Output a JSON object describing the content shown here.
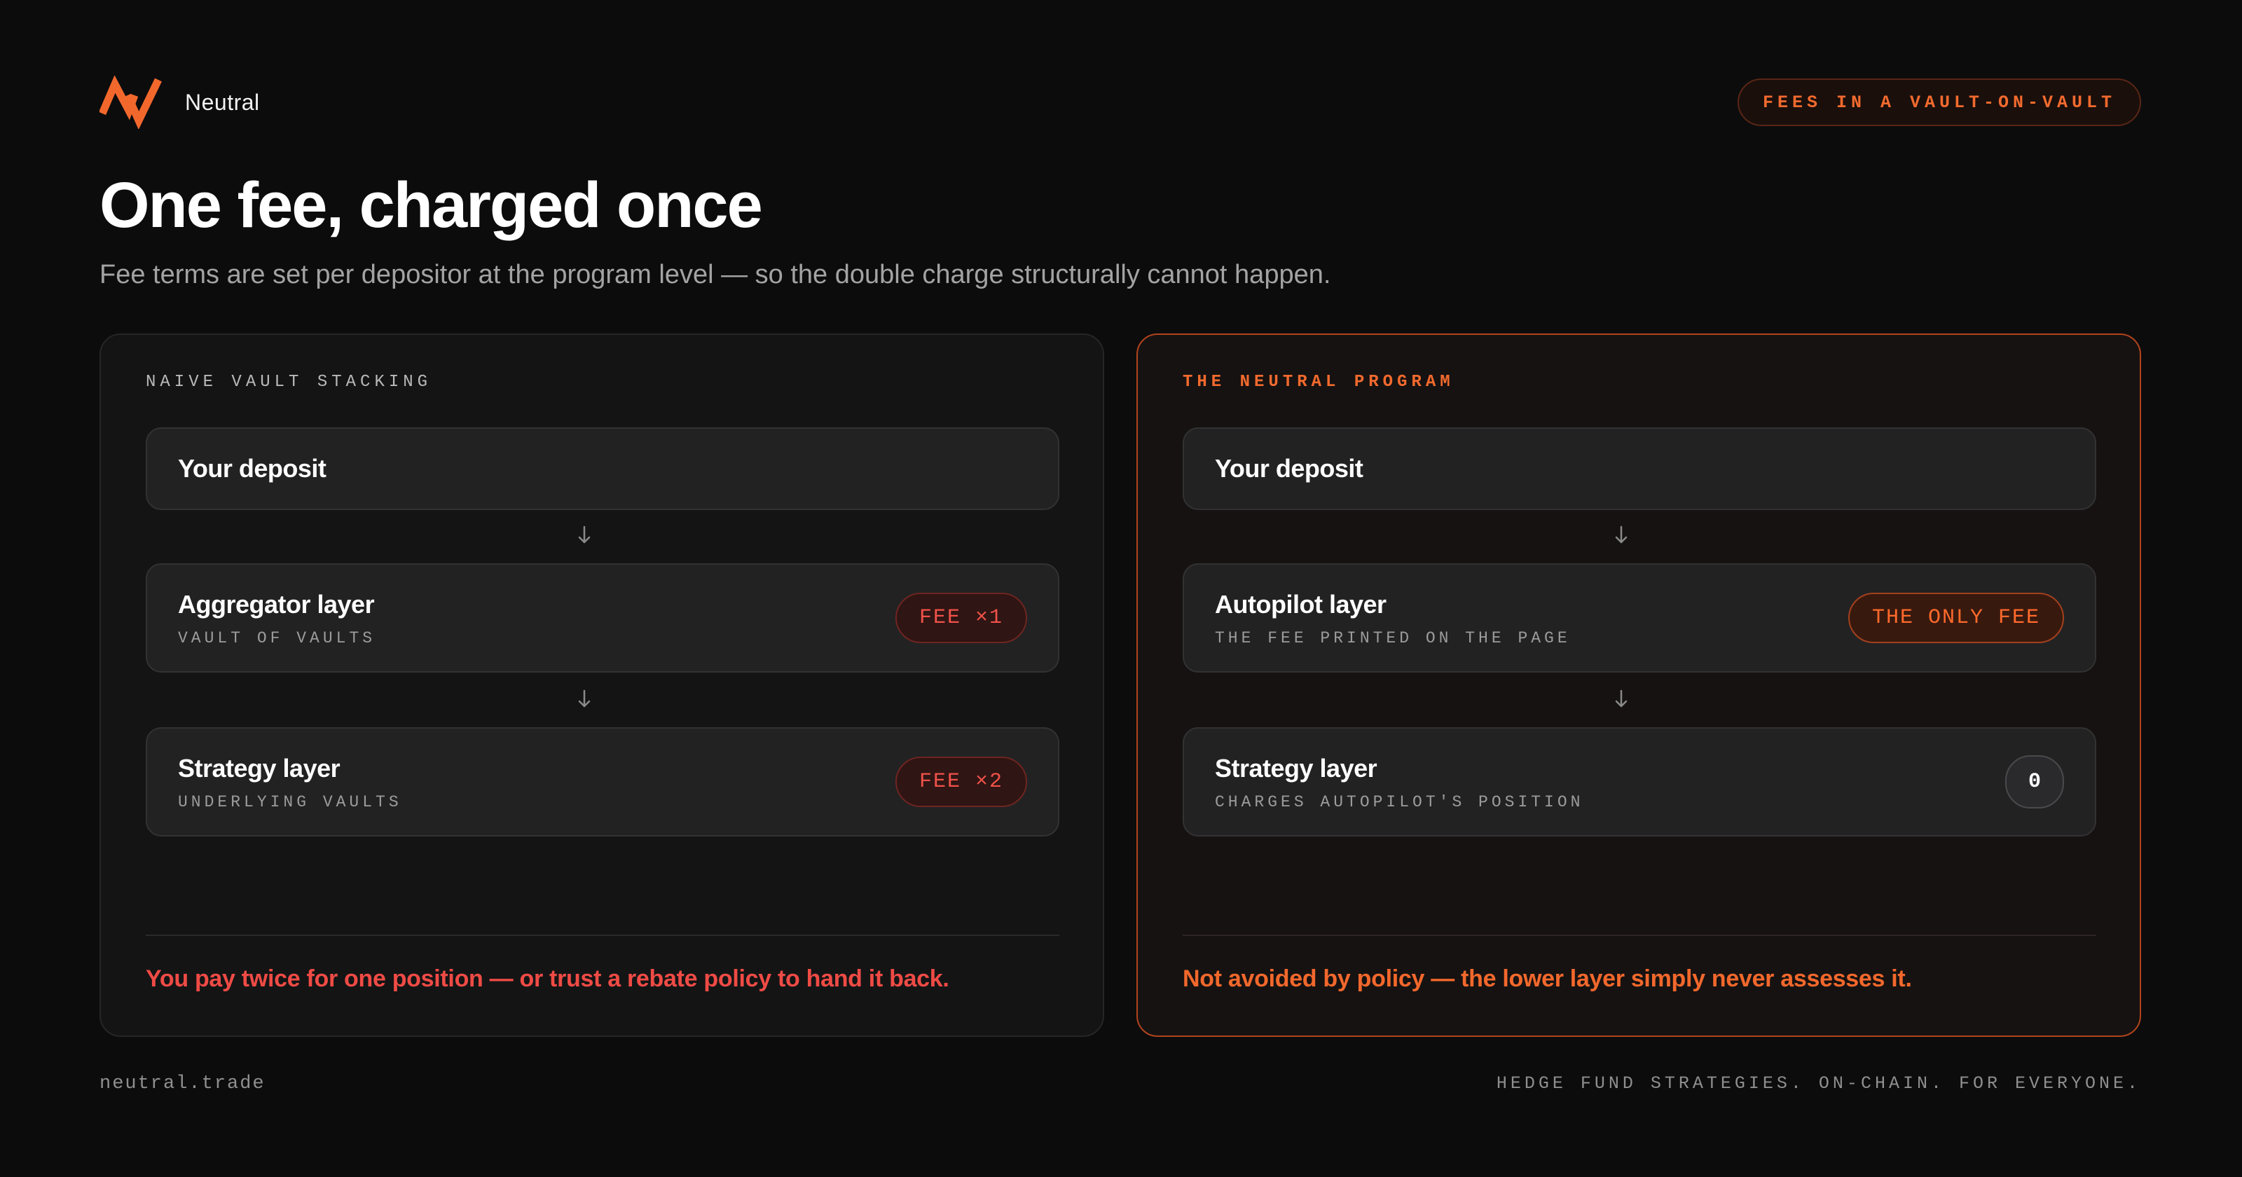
{
  "header": {
    "brand_name": "Neutral",
    "tag": "FEES IN A VAULT-ON-VAULT"
  },
  "title": "One fee, charged once",
  "subtitle": "Fee terms are set per depositor at the program level — so the double charge structurally cannot happen.",
  "colors": {
    "accent": "#f26a2e",
    "warning_red": "#ef4b45",
    "background": "#0c0c0d"
  },
  "naive_panel": {
    "eyebrow": "NAIVE VAULT STACKING",
    "deposit": "Your deposit",
    "layer1_title": "Aggregator layer",
    "layer1_sub": "VAULT OF VAULTS",
    "layer1_badge": "FEE ×1",
    "layer2_title": "Strategy layer",
    "layer2_sub": "UNDERLYING VAULTS",
    "layer2_badge": "FEE ×2",
    "footnote": "You pay twice for one position — or trust a rebate policy to hand it back."
  },
  "neutral_panel": {
    "eyebrow": "THE NEUTRAL PROGRAM",
    "deposit": "Your deposit",
    "layer1_title": "Autopilot layer",
    "layer1_sub": "THE FEE PRINTED ON THE PAGE",
    "layer1_badge": "THE ONLY FEE",
    "layer2_title": "Strategy layer",
    "layer2_sub": "CHARGES AUTOPILOT'S POSITION",
    "layer2_badge": "0",
    "footnote": "Not avoided by policy — the lower layer simply never assesses it."
  },
  "footer": {
    "site": "neutral.trade",
    "tagline": "HEDGE FUND STRATEGIES. ON-CHAIN. FOR EVERYONE."
  }
}
